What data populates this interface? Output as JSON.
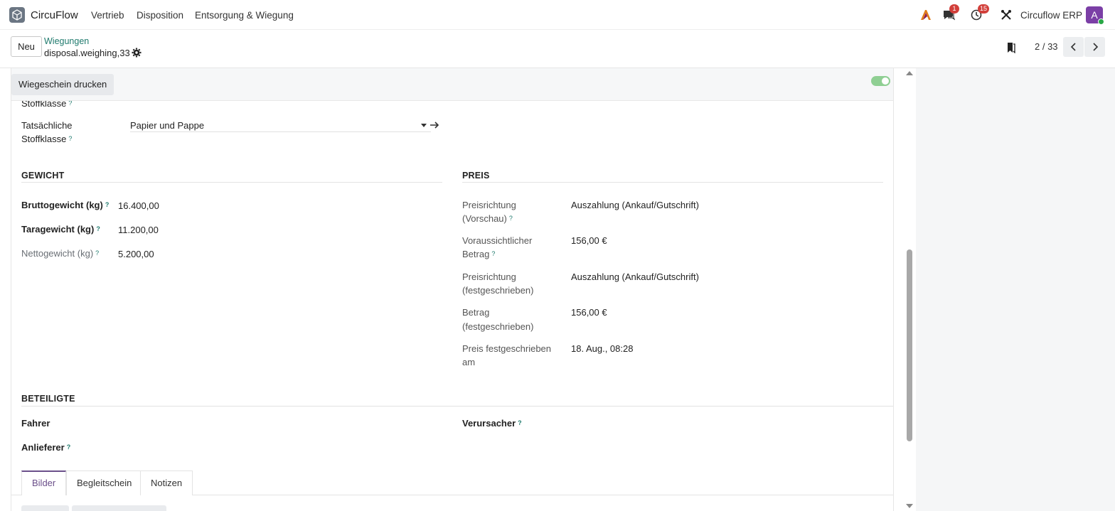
{
  "navbar": {
    "app_name": "CircuFlow",
    "menu": [
      "Vertrieb",
      "Disposition",
      "Entsorgung & Wiegung"
    ],
    "messages_count": "1",
    "activities_count": "15",
    "company": "Circuflow ERP",
    "avatar_letter": "A"
  },
  "control": {
    "new_label": "Neu",
    "breadcrumb": "Wiegungen",
    "record_name": "disposal.weighing,33",
    "pager": "2 / 33"
  },
  "statusbar": {
    "print_label": "Wiegeschein drucken"
  },
  "top_fields": {
    "cut_label": "Stoffklasse",
    "actual_class_label_1": "Tatsächliche",
    "actual_class_label_2": "Stoffklasse",
    "actual_class_value": "Papier und Pappe"
  },
  "weight": {
    "title": "GEWICHT",
    "gross_label": "Bruttogewicht (kg)",
    "gross_value": "16.400,00",
    "tare_label": "Taragewicht (kg)",
    "tare_value": "11.200,00",
    "net_label": "Nettogewicht (kg)",
    "net_value": "5.200,00"
  },
  "price": {
    "title": "PREIS",
    "direction_preview_label_1": "Preisrichtung",
    "direction_preview_label_2": "(Vorschau)",
    "direction_preview_value": "Auszahlung (Ankauf/Gutschrift)",
    "expected_amount_label_1": "Voraussichtlicher",
    "expected_amount_label_2": "Betrag",
    "expected_amount_value": "156,00 €",
    "direction_fixed_label_1": "Preisrichtung",
    "direction_fixed_label_2": "(festgeschrieben)",
    "direction_fixed_value": "Auszahlung (Ankauf/Gutschrift)",
    "amount_fixed_label_1": "Betrag",
    "amount_fixed_label_2": "(festgeschrieben)",
    "amount_fixed_value": "156,00 €",
    "fixed_on_label_1": "Preis festgeschrieben",
    "fixed_on_label_2": "am",
    "fixed_on_value": "18. Aug., 08:28"
  },
  "parties": {
    "title": "BETEILIGTE",
    "driver_label": "Fahrer",
    "supplier_label": "Anlieferer",
    "originator_label": "Verursacher"
  },
  "tabs": [
    "Bilder",
    "Begleitschein",
    "Notizen"
  ],
  "help_mark": "?",
  "colors": {
    "accent": "#1f7a6d",
    "tab_active": "#6b4f8a",
    "badge": "#d23f3a",
    "avatar": "#7b3fa6",
    "toggle": "#8fcf93"
  }
}
